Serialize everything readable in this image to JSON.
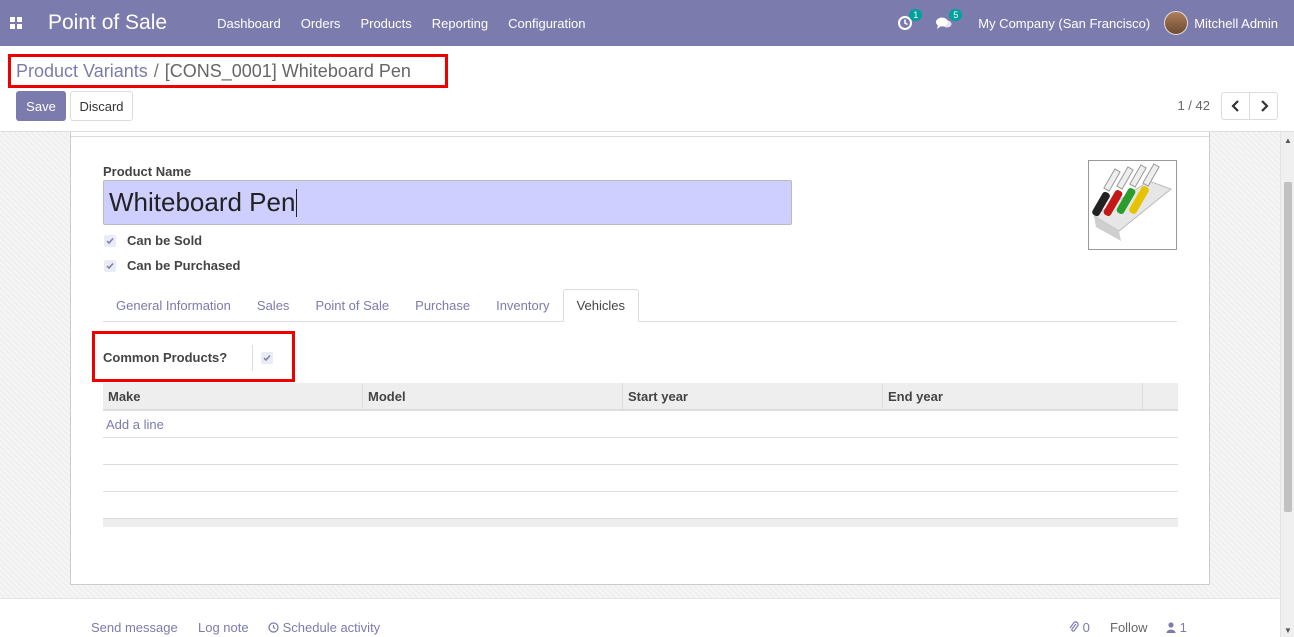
{
  "navbar": {
    "app_title": "Point of Sale",
    "menu": [
      "Dashboard",
      "Orders",
      "Products",
      "Reporting",
      "Configuration"
    ],
    "activity_count": "1",
    "message_count": "5",
    "company": "My Company (San Francisco)",
    "user": "Mitchell Admin"
  },
  "breadcrumb": {
    "parent": "Product Variants",
    "separator": "/",
    "current": "[CONS_0001] Whiteboard Pen"
  },
  "actions": {
    "save": "Save",
    "discard": "Discard"
  },
  "pager": {
    "value": "1 / 42"
  },
  "form": {
    "name_label": "Product Name",
    "name_value": "Whiteboard Pen",
    "can_be_sold": "Can be Sold",
    "can_be_purchased": "Can be Purchased",
    "tabs": [
      "General Information",
      "Sales",
      "Point of Sale",
      "Purchase",
      "Inventory",
      "Vehicles"
    ],
    "active_tab": "Vehicles",
    "common_products_label": "Common Products?",
    "table_headers": [
      "Make",
      "Model",
      "Start year",
      "End year"
    ],
    "add_line": "Add a line"
  },
  "chatter": {
    "send_message": "Send message",
    "log_note": "Log note",
    "schedule_activity": "Schedule activity",
    "attachments": "0",
    "follow": "Follow",
    "followers": "1"
  },
  "colors": {
    "brand": "#7c7bad",
    "highlight": "#ee0000",
    "name_field": "#cfcfff"
  },
  "icons": [
    "apps-icon",
    "clock-icon",
    "chat-icon",
    "chevron-left-icon",
    "chevron-right-icon",
    "check-icon",
    "paperclip-icon",
    "user-icon"
  ]
}
